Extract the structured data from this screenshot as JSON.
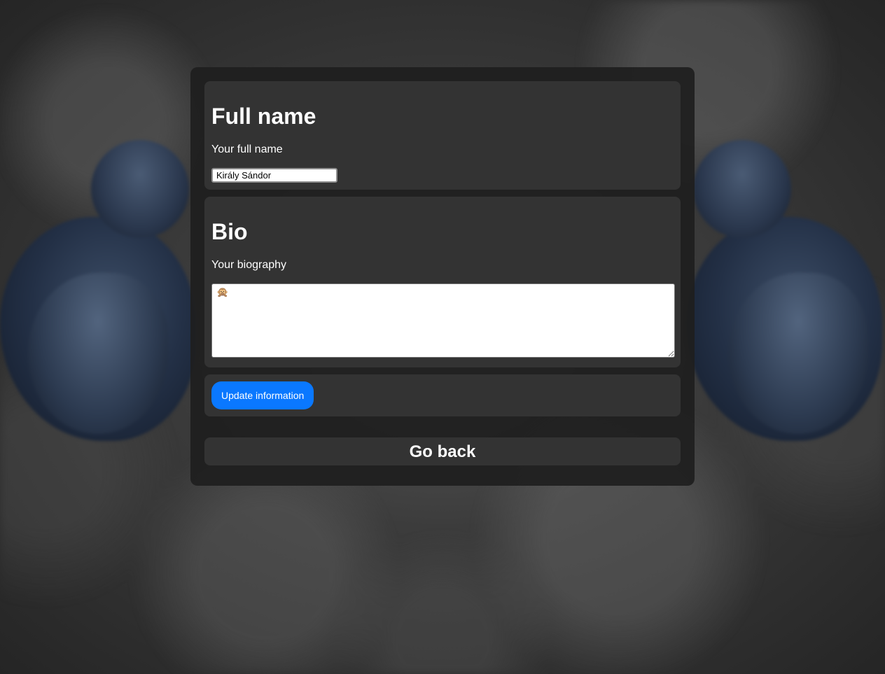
{
  "full_name_section": {
    "title": "Full name",
    "label": "Your full name",
    "value": "Király Sándor"
  },
  "bio_section": {
    "title": "Bio",
    "label": "Your biography",
    "value": "🙊"
  },
  "actions": {
    "update_label": "Update information",
    "go_back_label": "Go back"
  },
  "colors": {
    "accent": "#0a78ff",
    "card": "#333333",
    "panel": "#1e1e1e"
  }
}
